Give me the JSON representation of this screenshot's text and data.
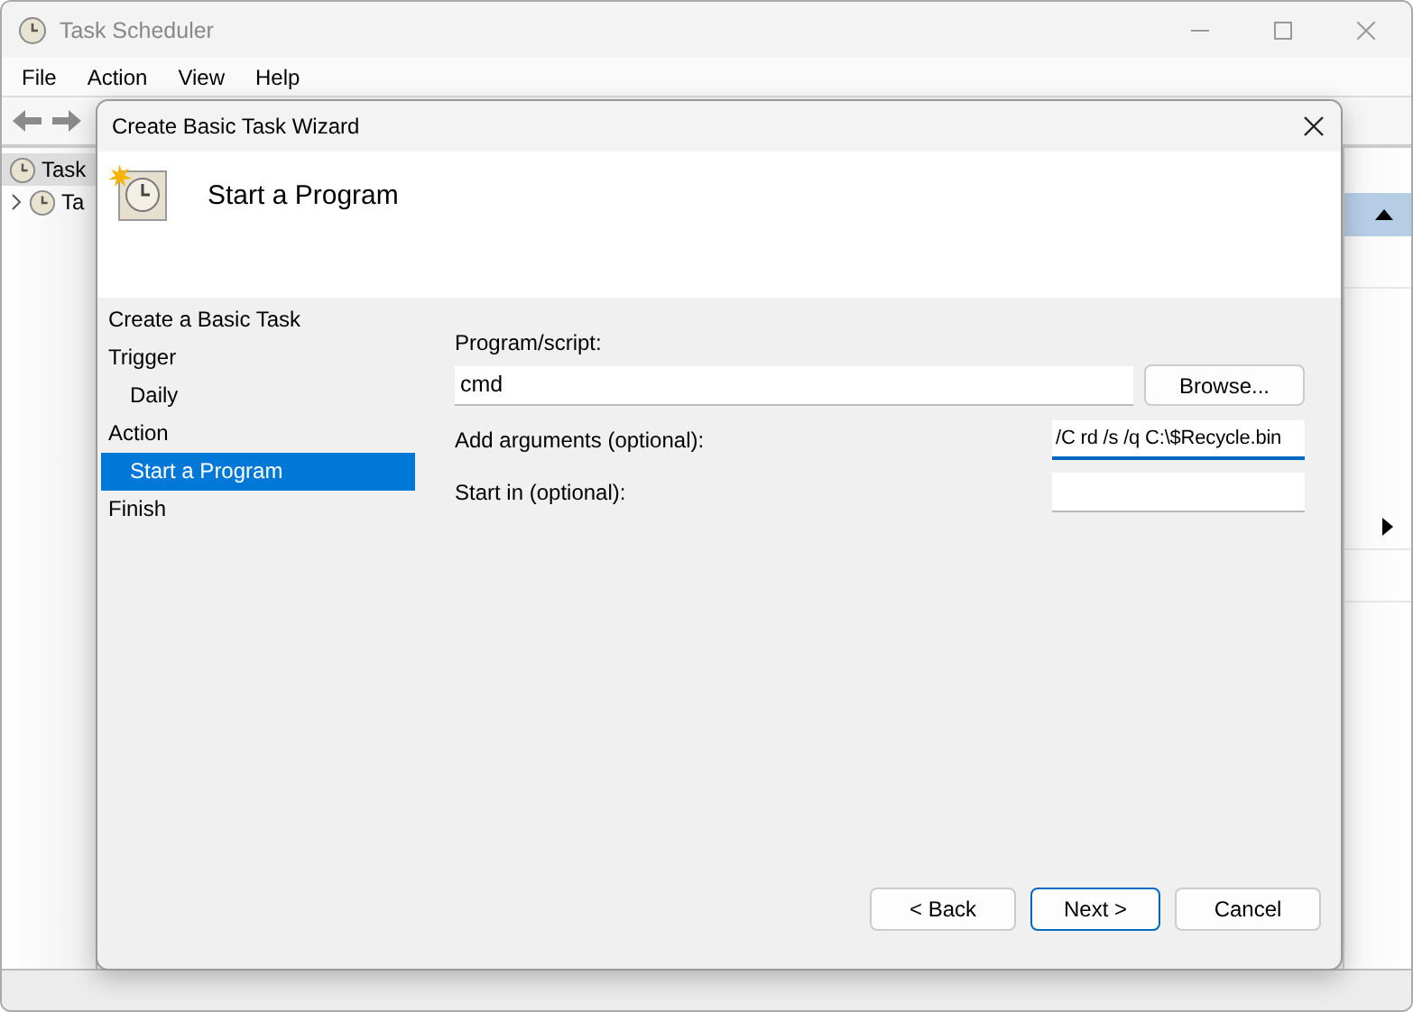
{
  "window": {
    "title": "Task Scheduler"
  },
  "menu": [
    "File",
    "Action",
    "View",
    "Help"
  ],
  "tree": [
    {
      "label": "Task",
      "selected": true,
      "expandable": false
    },
    {
      "label": "Ta",
      "selected": false,
      "expandable": true
    }
  ],
  "dialog": {
    "title": "Create Basic Task Wizard",
    "heading": "Start a Program",
    "steps": [
      {
        "label": "Create a Basic Task",
        "selected": false
      },
      {
        "label": "Trigger",
        "selected": false,
        "children": [
          {
            "label": "Daily",
            "selected": false
          }
        ]
      },
      {
        "label": "Action",
        "selected": false,
        "children": [
          {
            "label": "Start a Program",
            "selected": true
          }
        ]
      },
      {
        "label": "Finish",
        "selected": false
      }
    ],
    "fields": [
      {
        "kind": "path",
        "label": "Program/script:",
        "value": "cmd",
        "button": "Browse...",
        "focused": false
      },
      {
        "kind": "text",
        "label": "Add arguments (optional):",
        "value": "/C rd /s /q C:\\$Recycle.bin",
        "focused": true
      },
      {
        "kind": "text",
        "label": "Start in (optional):",
        "focused": false
      }
    ],
    "buttons": [
      {
        "label": "< Back",
        "default": false
      },
      {
        "label": "Next >",
        "default": true
      },
      {
        "label": "Cancel",
        "default": false
      }
    ]
  }
}
